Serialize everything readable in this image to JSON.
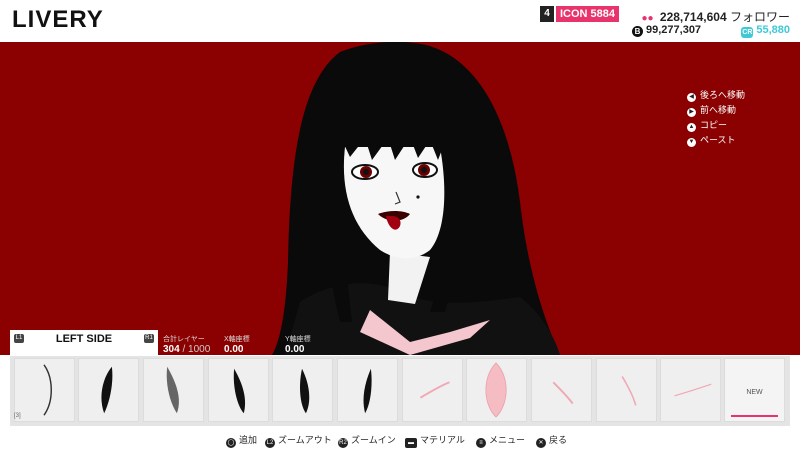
{
  "header": {
    "title": "LIVERY",
    "rank": "4",
    "icon_level": "ICON 5884",
    "followers_count": "228,714,604",
    "followers_label": "フォロワー",
    "credits": "99,277,307",
    "cr": "55,880"
  },
  "side_menu": {
    "items": [
      {
        "label": "後ろへ移動"
      },
      {
        "label": "前へ移動"
      },
      {
        "label": "コピー"
      },
      {
        "label": "ペースト"
      }
    ]
  },
  "layer_panel": {
    "title": "LEFT SIDE",
    "btn_left": "L1",
    "btn_right": "R1",
    "total_layers_label": "合計レイヤー",
    "total_layers_value": "304",
    "total_layers_max": "/ 1000",
    "x_label": "X軸座標",
    "x_value": "0.00",
    "y_label": "Y軸座標",
    "y_value": "0.00"
  },
  "shape_strip": {
    "count_label": "[3]",
    "new_label": "NEW"
  },
  "controls": [
    {
      "label": "追加"
    },
    {
      "label": "ズームアウト"
    },
    {
      "label": "ズームイン"
    },
    {
      "label": "マテリアル"
    },
    {
      "label": "メニュー"
    },
    {
      "label": "戻る"
    }
  ],
  "colors": {
    "accent": "#e8336c",
    "canvas_bg": "#8b0000",
    "cr_accent": "#3fc9d6"
  }
}
